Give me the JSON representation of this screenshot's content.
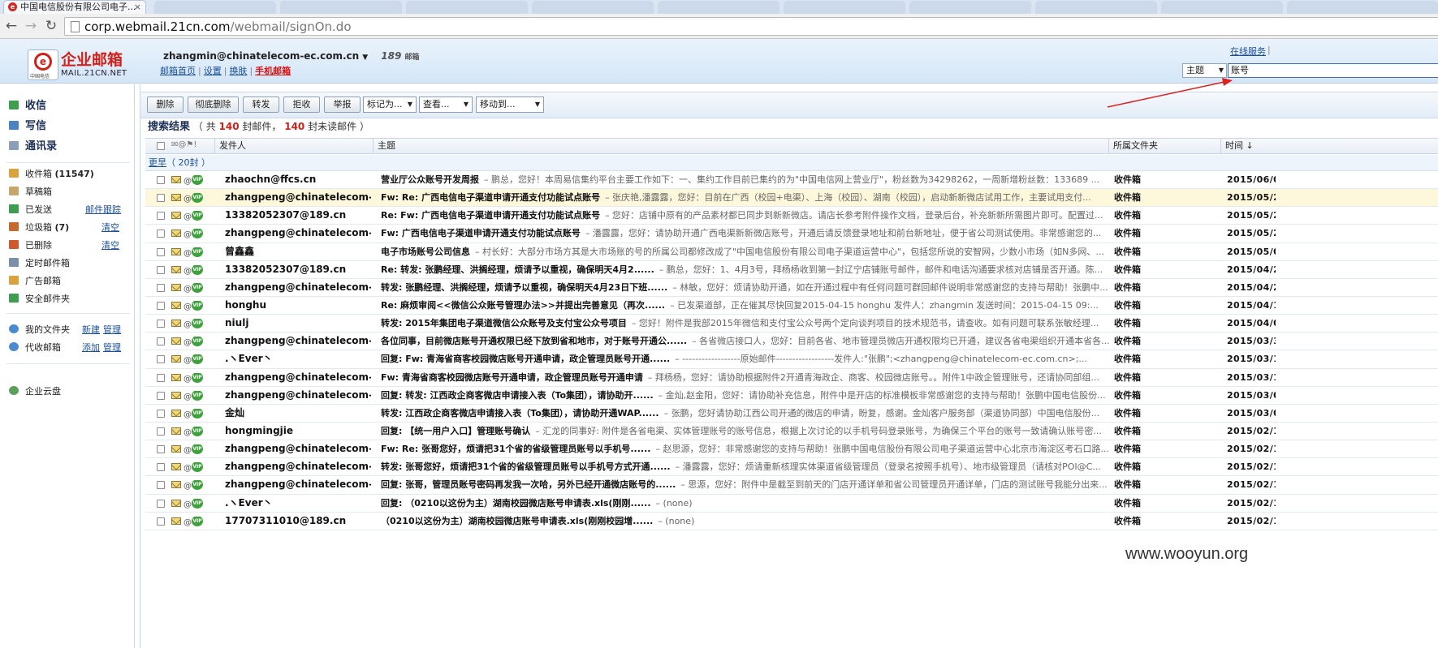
{
  "browser": {
    "tab_title": "中国电信股份有限公司电子...",
    "tab_close": "×",
    "back_icon": "arrow-left-icon",
    "forward_icon": "arrow-right-icon",
    "reload_icon": "reload-icon",
    "url_host": "corp.webmail.21cn.com",
    "url_path": "/webmail/signOn.do"
  },
  "header": {
    "brand_cn": "企业邮箱",
    "brand_en": "MAIL.21CN.NET",
    "logo_sub": "中国电信",
    "user_email": "zhangmin@chinatelecom-ec.com.cn",
    "badge": "189",
    "badge_sub": "邮箱",
    "links": {
      "home": "邮箱首页",
      "settings": "设置",
      "skin": "换肤",
      "mobile": "手机邮箱"
    },
    "online_service": "在线服务",
    "search_field": "主题",
    "search_value": "账号"
  },
  "sidebar": {
    "inbox_action": "收信",
    "compose_action": "写信",
    "contacts_action": "通讯录",
    "folders": [
      {
        "label": "收件箱",
        "count": "(11547)",
        "color": "#d9a23a"
      },
      {
        "label": "草稿箱",
        "color": "#c8a56a"
      },
      {
        "label": "已发送",
        "link": "邮件跟踪",
        "color": "#3d9e4f"
      },
      {
        "label": "垃圾箱",
        "count": "(7)",
        "link": "清空",
        "color": "#c96a2d"
      },
      {
        "label": "已删除",
        "link": "清空",
        "color": "#d1572d"
      },
      {
        "label": "定时邮件箱",
        "color": "#7a8fa8"
      },
      {
        "label": "广告邮箱",
        "color": "#d9a23a"
      },
      {
        "label": "安全邮件夹",
        "color": "#3d9e4f"
      }
    ],
    "my_folders": {
      "label": "我的文件夹",
      "link1": "新建",
      "link2": "管理"
    },
    "proxy_mail": {
      "label": "代收邮箱",
      "link1": "添加",
      "link2": "管理"
    },
    "cloud": "企业云盘"
  },
  "actions": {
    "delete": "删除",
    "delete_forever": "彻底删除",
    "forward": "转发",
    "reject": "拒收",
    "report": "举报",
    "mark_as": "标记为...",
    "view": "查看...",
    "move_to": "移动到..."
  },
  "results": {
    "title": "搜索结果",
    "open": "（ 共",
    "total": "140",
    "mid": "封邮件，",
    "unread": "140",
    "tail": "封未读邮件 ）"
  },
  "columns": {
    "sender": "发件人",
    "subject": "主题",
    "folder": "所属文件夹",
    "time": "时间 ↓"
  },
  "group": {
    "label": "更早",
    "count": "（ 20封 ）"
  },
  "emails": [
    {
      "sender": "zhaochn@ffcs.cn",
      "subject": "营业厅公众账号开发周报",
      "preview": "– 鹏总，您好！本周易信集约平台主要工作如下：一、集约工作目前已集约的为\"中国电信网上营业厅\"，粉丝数为34298262，一周新增粉丝数：133689 ...",
      "folder": "收件箱",
      "time": "2015/06/0"
    },
    {
      "sender": "zhangpeng@chinatelecom-...",
      "subject": "Fw: Re: 广西电信电子渠道申请开通支付功能试点账号",
      "preview": "– 张庆艳,潘露露，您好：目前在广西（校园+电渠）、上海（校园）、湖南（校园），启动新新微店试用工作，主要试用支付...",
      "folder": "收件箱",
      "time": "2015/05/2",
      "highlight": true
    },
    {
      "sender": "13382052307@189.cn",
      "subject": "Re: Fw: 广西电信电子渠道申请开通支付功能试点账号",
      "preview": "– 您好：店铺中原有的产品素材都已同步到新新微店。请店长参考附件操作文档，登录后台，补充新新所需图片即可。配置过...",
      "folder": "收件箱",
      "time": "2015/05/2"
    },
    {
      "sender": "zhangpeng@chinatelecom-...",
      "subject": "Fw: 广西电信电子渠道申请开通支付功能试点账号",
      "preview": "– 潘露露，您好：请协助开通广西电渠新新微店账号，开通后请反馈登录地址和前台新地址，便于省公司测试使用。非常感谢您的...",
      "folder": "收件箱",
      "time": "2015/05/2"
    },
    {
      "sender": "曾鑫鑫",
      "subject": "电子市场账号公司信息",
      "preview": "– 村长好：大部分市场方其是大市场账的号的所属公司都修改成了\"中国电信股份有限公司电子渠道运营中心\"，包括您所说的安智网，少数小市场（如N多网、...",
      "folder": "收件箱",
      "time": "2015/05/0"
    },
    {
      "sender": "13382052307@189.cn",
      "subject": "Re: 转发: 张鹏经理、洪搁经理，烦请予以重视，确保明天4月2......",
      "preview": "– 鹏总，您好：1、4月3号，拜杨杨收到第一封辽宁店铺账号邮件，邮件和电话沟通要求核对店铺是否开通。陈...",
      "folder": "收件箱",
      "time": "2015/04/2"
    },
    {
      "sender": "zhangpeng@chinatelecom-...",
      "subject": "转发: 张鹏经理、洪搁经理，烦请予以重视，确保明天4月23日下班......",
      "preview": "– 林敏，您好：烦请协助开通，如在开通过程中有任何问题可群回邮件说明非常感谢您的支持与帮助！张鹏中...",
      "folder": "收件箱",
      "time": "2015/04/2"
    },
    {
      "sender": "honghu",
      "subject": "Re: 麻烦审阅<<微信公众账号管理办法>>并提出完善意见（再次......",
      "preview": "– 已发渠道部，正在催其尽快回复2015-04-15 honghu 发件人：zhangmin 发送时间：2015-04-15 09:...",
      "folder": "收件箱",
      "time": "2015/04/1"
    },
    {
      "sender": "niulj",
      "subject": "转发: 2015年集团电子渠道微信公众账号及支付宝公众号项目",
      "preview": "– 您好！附件是我部2015年微信和支付宝公众号两个定向谈判项目的技术规范书，请查收。如有问题可联系张敏经理...",
      "folder": "收件箱",
      "time": "2015/04/0"
    },
    {
      "sender": "zhangpeng@chinatelecom-...",
      "subject": "各位同事，目前微店账号开通权限已经下放到省和地市，对于账号开通公......",
      "preview": "– 各省微店接口人，您好：目前各省、地市管理员微店开通权限均已开通，建议各省电渠组织开通本省各...",
      "folder": "收件箱",
      "time": "2015/03/3"
    },
    {
      "sender": ".ヽEver丶",
      "subject": "回复: Fw: 青海省商客校园微店账号开通申请，政企管理员账号开通......",
      "preview": "– ------------------原始邮件------------------发件人:\"张鹏\";<zhangpeng@chinatelecom-ec.com.cn>;...",
      "folder": "收件箱",
      "time": "2015/03/1"
    },
    {
      "sender": "zhangpeng@chinatelecom-...",
      "subject": "Fw: 青海省商客校园微店账号开通申请，政企管理员账号开通申请",
      "preview": "– 拜杨杨，您好：请协助根据附件2开通青海政企、商客、校园微店账号。。附件1中政企管理账号，还请协同部组...",
      "folder": "收件箱",
      "time": "2015/03/1"
    },
    {
      "sender": "zhangpeng@chinatelecom-...",
      "subject": "回复: 转发: 江西政企商客微店申请接入表（To集团），请协助开......",
      "preview": "– 金灿,赵金阳，您好：请协助补充信息，附件中是开店的标准模板非常感谢您的支持与帮助！张鹏中国电信股份...",
      "folder": "收件箱",
      "time": "2015/03/0"
    },
    {
      "sender": "金灿",
      "subject": "转发: 江西政企商客微店申请接入表（To集团），请协助开通WAP......",
      "preview": "– 张鹏，您好请协助江西公司开通的微店的申请，盼复，感谢。金灿客户服务部（渠道协同部）中国电信股份...",
      "folder": "收件箱",
      "time": "2015/03/0"
    },
    {
      "sender": "hongmingjie",
      "subject": "回复: 【统一用户入口】管理账号确认",
      "preview": "– 汇龙的同事好: 附件是各省电渠、实体管理账号的账号信息，根据上次讨论的以手机号码登录账号，为确保三个平台的账号一致请确认账号密...",
      "folder": "收件箱",
      "time": "2015/02/1"
    },
    {
      "sender": "zhangpeng@chinatelecom-...",
      "subject": "Fw: Re: 张哥您好，烦请把31个省的省级管理员账号以手机号......",
      "preview": "– 赵思源，您好：非常感谢您的支持与帮助！张鹏中国电信股份有限公司电子渠道运营中心北京市海淀区考石口路...",
      "folder": "收件箱",
      "time": "2015/02/1"
    },
    {
      "sender": "zhangpeng@chinatelecom-...",
      "subject": "转发: 张哥您好，烦请把31个省的省级管理员账号以手机号方式开通......",
      "preview": "– 潘露露，您好：烦请重新核理实体渠道省级管理员（登录名按照手机号）、地市级管理员（请核对POI@C...",
      "folder": "收件箱",
      "time": "2015/02/1"
    },
    {
      "sender": "zhangpeng@chinatelecom-...",
      "subject": "回复: 张哥，管理员账号密码再发我一次哈，另外已经开通微店账号的......",
      "preview": "– 思源，您好：附件中是截至到前天的门店开通详单和省公司管理员开通详单，门店的测试账号我能分出来...",
      "folder": "收件箱",
      "time": "2015/02/1"
    },
    {
      "sender": ".ヽEver丶",
      "subject": "回复: （0210以这份为主）湖南校园微店账号申请表.xls(刚刚......",
      "preview": "– (none)",
      "folder": "收件箱",
      "time": "2015/02/1"
    },
    {
      "sender": "17707311010@189.cn",
      "subject": "（0210以这份为主）湖南校园微店账号申请表.xls(刚刚校园增......",
      "preview": "– (none)",
      "folder": "收件箱",
      "time": "2015/02/1"
    }
  ],
  "watermark": "www.wooyun.org",
  "colors": {
    "accent_red": "#d21f18",
    "link_blue": "#1a4f9c",
    "annotation_red": "#e02020"
  }
}
